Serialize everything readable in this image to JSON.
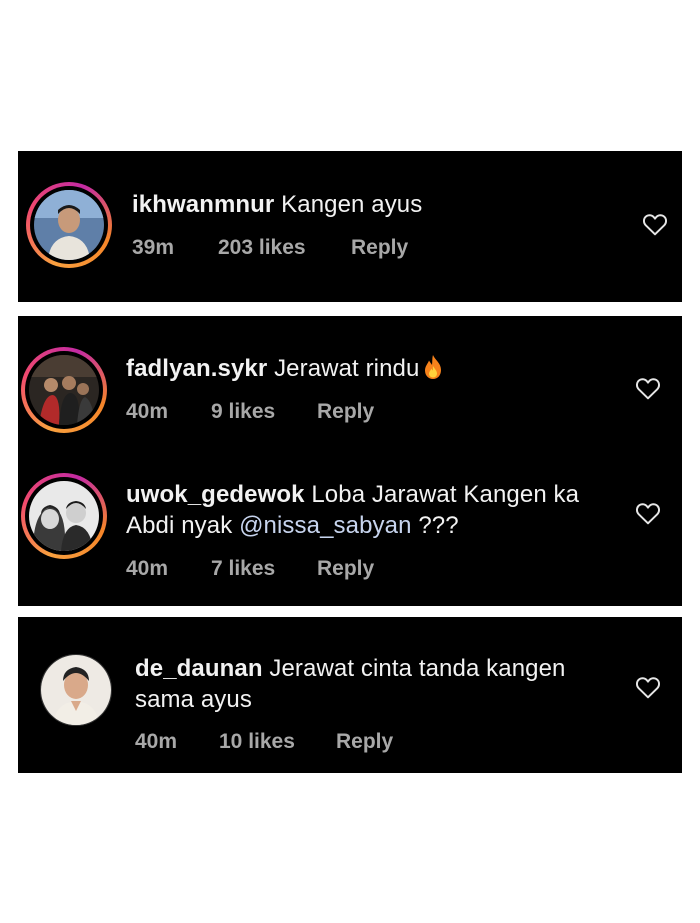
{
  "comments": [
    {
      "username": "ikhwanmnur",
      "text": "Kangen ayus",
      "time": "39m",
      "likes": "203 likes",
      "reply": "Reply",
      "avatar_icon": "profile-photo-man"
    },
    {
      "username": "fadlyan.sykr",
      "text": "Jerawat rindu",
      "emoji_icon": "fire-icon",
      "time": "40m",
      "likes": "9 likes",
      "reply": "Reply",
      "avatar_icon": "profile-photo-group"
    },
    {
      "username": "uwok_gedewok",
      "text": "Loba Jarawat Kangen ka Abdi nyak",
      "mention": "@nissa_sabyan",
      "text_suffix": "???",
      "time": "40m",
      "likes": "7 likes",
      "reply": "Reply",
      "avatar_icon": "profile-photo-couple"
    },
    {
      "username": "de_daunan",
      "text": "Jerawat cinta tanda kangen sama ayus",
      "time": "40m",
      "likes": "10 likes",
      "reply": "Reply",
      "avatar_icon": "profile-photo-man"
    }
  ],
  "colors": {
    "background": "#000000",
    "page": "#ffffff",
    "text": "#f2f2f2",
    "meta": "#a8a8a8",
    "mention": "#c7d4ee",
    "story_ring": [
      "#f9a03f",
      "#f04a6e",
      "#c32aa3"
    ]
  }
}
